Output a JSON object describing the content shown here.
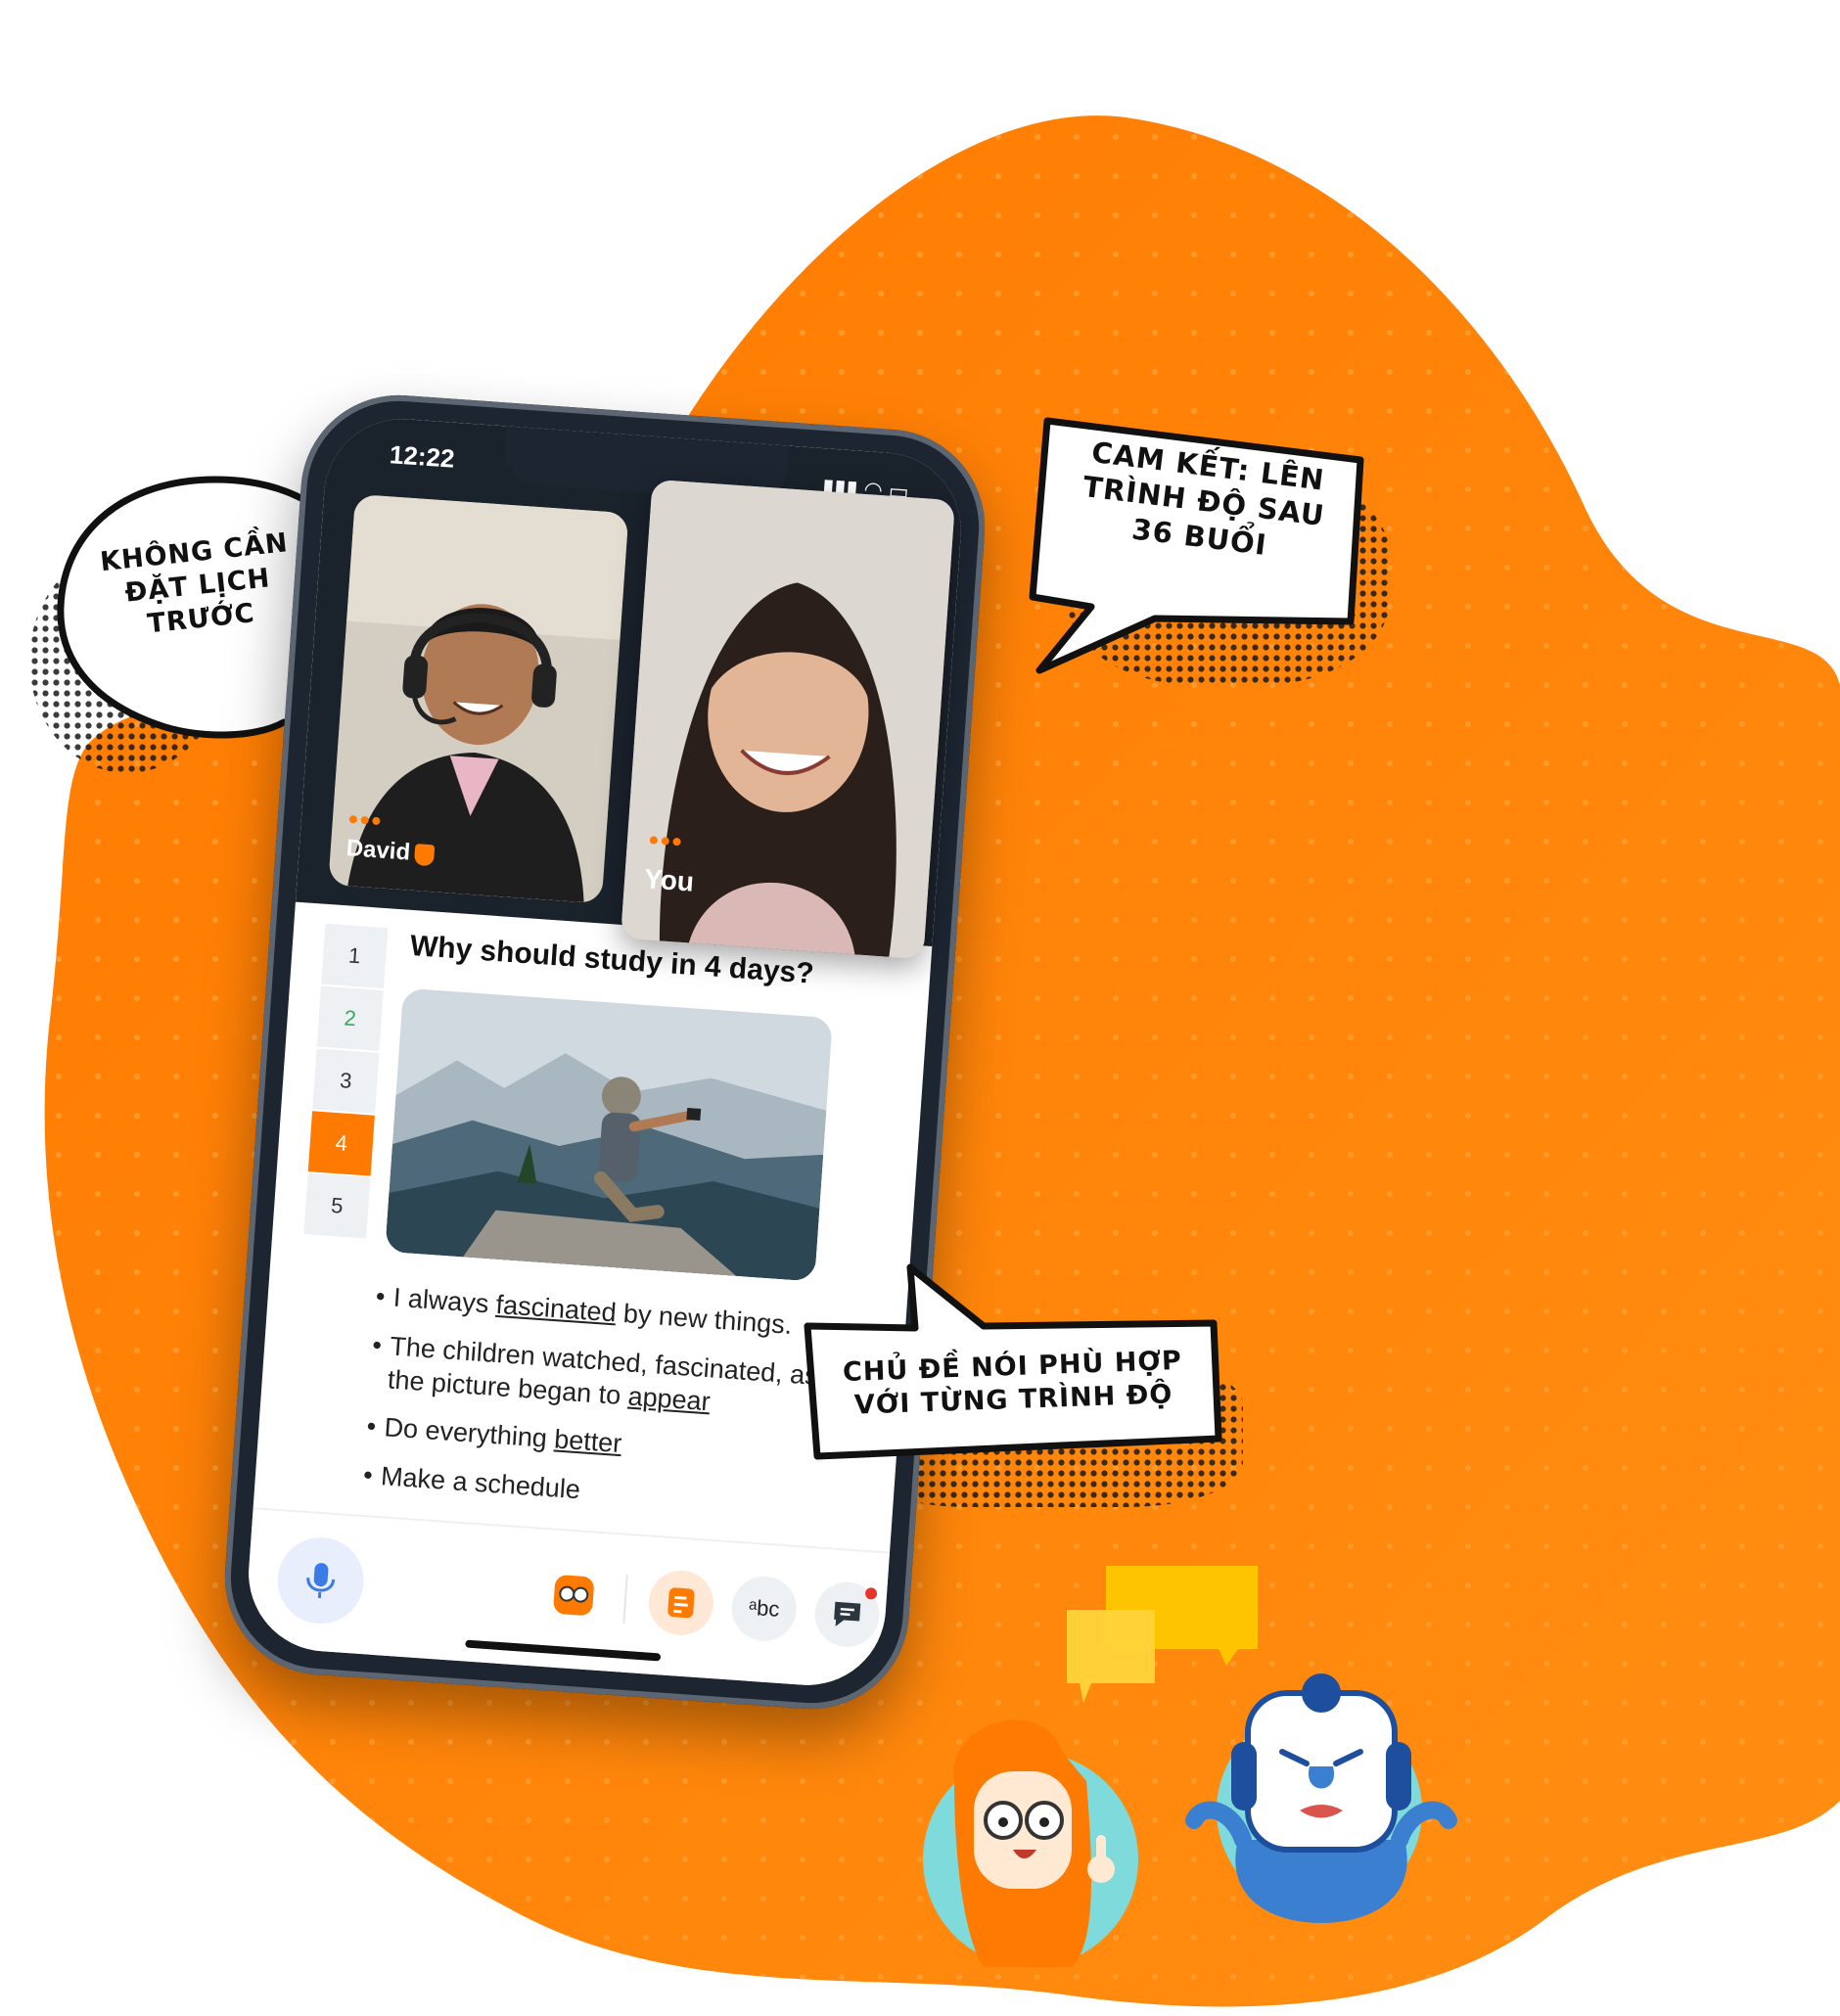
{
  "colors": {
    "brand_orange": "#ff8a00",
    "bubble_fill": "#ffffff",
    "bubble_stroke": "#111111",
    "speech_yellow": "#ffc400",
    "teal": "#7fd9d9",
    "mascot_blue": "#3b7fd1"
  },
  "bubbles": {
    "no_booking": [
      "Không cần",
      "đặt lịch",
      "trước"
    ],
    "commitment": [
      "Cam kết: Lên",
      "trình độ sau",
      "36 buổi"
    ],
    "topics": [
      "Chủ đề nói phù hợp",
      "với từng trình độ"
    ]
  },
  "status_bar": {
    "time": "12:22"
  },
  "call": {
    "tutor_name": "David",
    "self_label": "You"
  },
  "lesson": {
    "steps": [
      "1",
      "2",
      "3",
      "4",
      "5"
    ],
    "active_step": "4",
    "question": "Why should study in 4 days?",
    "bullets": [
      {
        "before": "I always ",
        "underlined": "fascinated",
        "after": " by new things."
      },
      {
        "before": "The children watched, fascinated, as the picture began to ",
        "underlined": "appear",
        "after": ""
      },
      {
        "before": "Do everything ",
        "underlined": "better",
        "after": ""
      },
      {
        "before": "Make a schedule",
        "underlined": "",
        "after": ""
      }
    ]
  },
  "toolbar": {
    "icons": [
      "microphone-icon",
      "tutor-face-icon",
      "document-icon",
      "abc-icon",
      "chat-icon"
    ]
  }
}
